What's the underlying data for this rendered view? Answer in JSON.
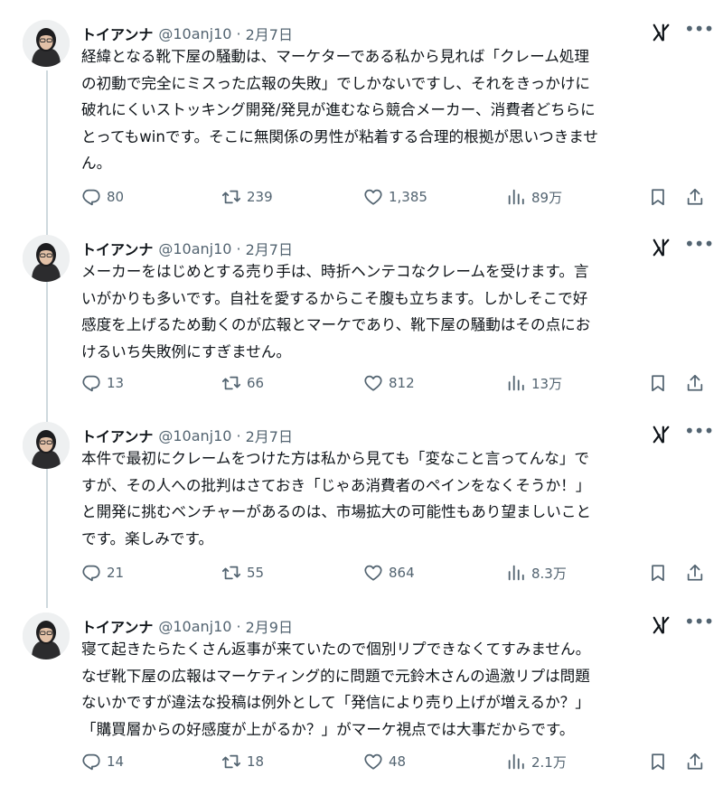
{
  "tweets": [
    {
      "author": "トイアンナ",
      "handle": "@10anj10",
      "separator": "·",
      "date": "2月7日",
      "text": "経緯となる靴下屋の騒動は、マーケターである私から見れば「クレーム処理\nの初動で完全にミスった広報の失敗」でしかないですし、それをきっかけに\n破れにくいストッキング開発/発見が進むなら競合メーカー、消費者どちらに\nとってもwinです。そこに無関係の男性が粘着する合理的根拠が思いつきませ\nん。",
      "replies": "80",
      "retweets": "239",
      "likes": "1,385",
      "views": "89万"
    },
    {
      "author": "トイアンナ",
      "handle": "@10anj10",
      "separator": "·",
      "date": "2月7日",
      "text": "メーカーをはじめとする売り手は、時折ヘンテコなクレームを受けます。言\nいがかりも多いです。自社を愛するからこそ腹も立ちます。しかしそこで好\n感度を上げるため動くのが広報とマーケであり、靴下屋の騒動はその点にお\nけるいち失敗例にすぎません。",
      "replies": "13",
      "retweets": "66",
      "likes": "812",
      "views": "13万"
    },
    {
      "author": "トイアンナ",
      "handle": "@10anj10",
      "separator": "·",
      "date": "2月7日",
      "text": "本件で最初にクレームをつけた方は私から見ても「変なこと言ってんな」で\nすが、その人への批判はさておき「じゃあ消費者のペインをなくそうか！」\nと開発に挑むベンチャーがあるのは、市場拡大の可能性もあり望ましいこと\nです。楽しみです。",
      "replies": "21",
      "retweets": "55",
      "likes": "864",
      "views": "8.3万"
    },
    {
      "author": "トイアンナ",
      "handle": "@10anj10",
      "separator": "·",
      "date": "2月9日",
      "text": "寝て起きたらたくさん返事が来ていたので個別リプできなくてすみません。\nなぜ靴下屋の広報はマーケティング的に問題で元鈴木さんの過激リプは問題\nないかですが違法な投稿は例外として「発信により売り上げが増えるか？」\n「購買層からの好感度が上がるか？」がマーケ視点では大事だからです。",
      "replies": "14",
      "retweets": "18",
      "likes": "48",
      "views": "2.1万"
    }
  ],
  "icons": {
    "reply": "reply-icon",
    "retweet": "retweet-icon",
    "like": "heart-icon",
    "views": "views-icon",
    "bookmark": "bookmark-icon",
    "share": "share-icon",
    "grok": "grok-icon",
    "more": "more-icon"
  },
  "colors": {
    "text": "#0f1419",
    "secondary": "#536471",
    "thread_line": "#cfd9de",
    "background": "#ffffff"
  }
}
